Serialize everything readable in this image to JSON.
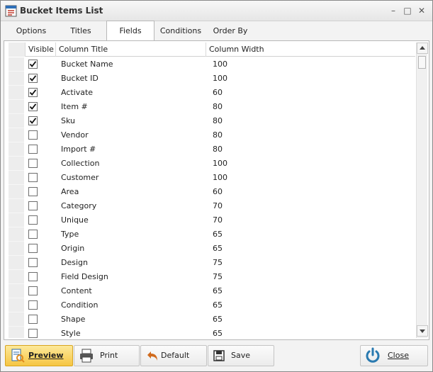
{
  "window": {
    "title": "Bucket Items List"
  },
  "tabs": [
    {
      "label": "Options"
    },
    {
      "label": "Titles"
    },
    {
      "label": "Fields"
    },
    {
      "label": "Conditions"
    },
    {
      "label": "Order By"
    }
  ],
  "active_tab": "Fields",
  "grid": {
    "columns": [
      "Visible",
      "Column Title",
      "Column Width"
    ],
    "rows": [
      {
        "visible": true,
        "title": "Bucket Name",
        "width": "100"
      },
      {
        "visible": true,
        "title": "Bucket ID",
        "width": "100"
      },
      {
        "visible": true,
        "title": "Activate",
        "width": "60"
      },
      {
        "visible": true,
        "title": "Item #",
        "width": "80"
      },
      {
        "visible": true,
        "title": "Sku",
        "width": "80"
      },
      {
        "visible": false,
        "title": "Vendor",
        "width": "80"
      },
      {
        "visible": false,
        "title": "Import #",
        "width": "80"
      },
      {
        "visible": false,
        "title": "Collection",
        "width": "100"
      },
      {
        "visible": false,
        "title": "Customer",
        "width": "100"
      },
      {
        "visible": false,
        "title": "Area",
        "width": "60"
      },
      {
        "visible": false,
        "title": "Category",
        "width": "70"
      },
      {
        "visible": false,
        "title": "Unique",
        "width": "70"
      },
      {
        "visible": false,
        "title": "Type",
        "width": "65"
      },
      {
        "visible": false,
        "title": "Origin",
        "width": "65"
      },
      {
        "visible": false,
        "title": "Design",
        "width": "75"
      },
      {
        "visible": false,
        "title": "Field Design",
        "width": "75"
      },
      {
        "visible": false,
        "title": "Content",
        "width": "65"
      },
      {
        "visible": false,
        "title": "Condition",
        "width": "65"
      },
      {
        "visible": false,
        "title": "Shape",
        "width": "65"
      },
      {
        "visible": false,
        "title": "Style",
        "width": "65"
      }
    ]
  },
  "footer": {
    "preview": "Preview",
    "print": "Print",
    "default": "Default",
    "save": "Save",
    "close": "Close"
  },
  "icons": {
    "app": "list-window-icon",
    "preview": "preview-document-icon",
    "print": "printer-icon",
    "default": "undo-arrow-icon",
    "save": "floppy-disk-icon",
    "close": "power-icon"
  },
  "colors": {
    "primary_button": "#f6c542",
    "close_icon": "#2a7ab0",
    "default_icon": "#d06a1c"
  }
}
